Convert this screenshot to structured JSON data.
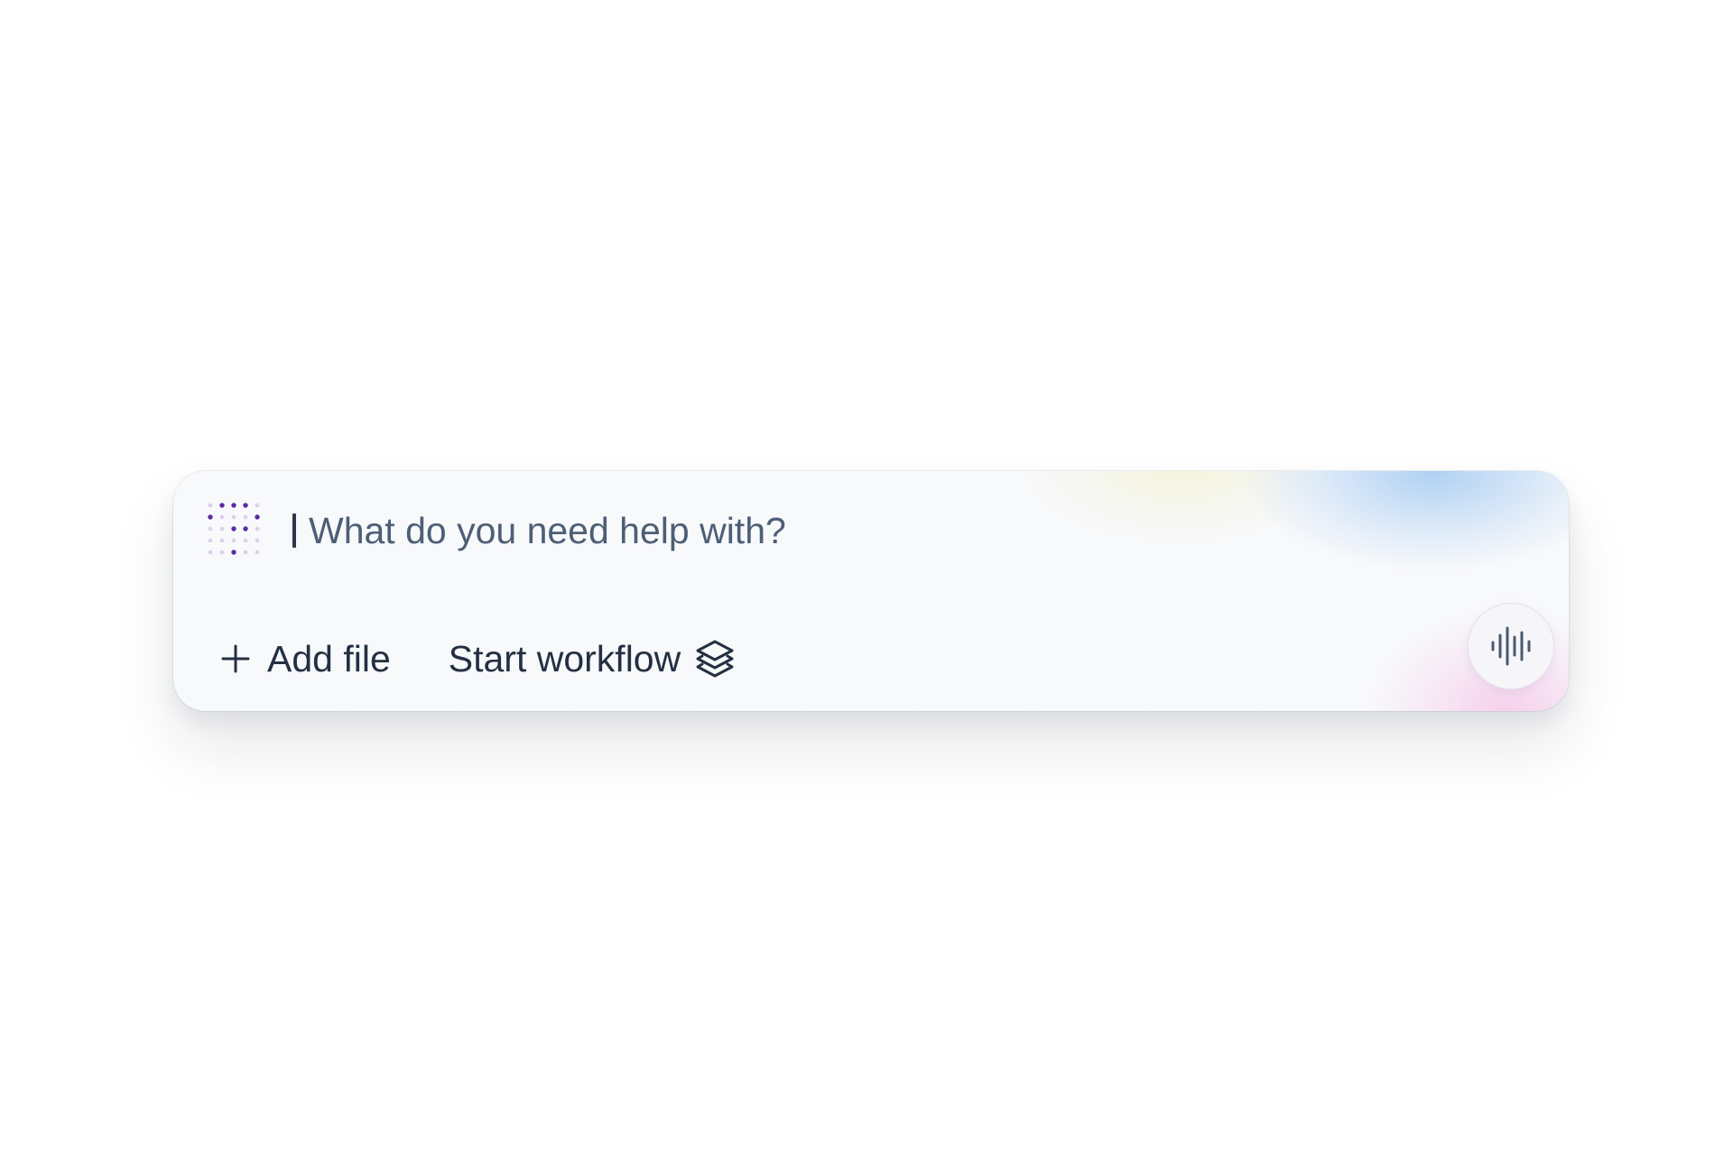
{
  "composer": {
    "placeholder": "What do you need help with?",
    "value": "",
    "logo_icon": "dot-grid-logo-icon",
    "accent_color": "#5b2aa0"
  },
  "actions": {
    "add_file": {
      "label": "Add file",
      "icon": "plus-icon"
    },
    "start_workflow": {
      "label": "Start workflow",
      "icon": "layers-icon"
    }
  },
  "voice": {
    "icon": "sound-wave-icon"
  },
  "colors": {
    "background": "#ffffff",
    "panel": "#f8f9fb",
    "text_primary": "#243042",
    "text_placeholder": "#4d5f76",
    "glow_blue": "#96c3f0",
    "glow_yellow": "#f0f0be",
    "glow_pink": "#f5bee6"
  }
}
